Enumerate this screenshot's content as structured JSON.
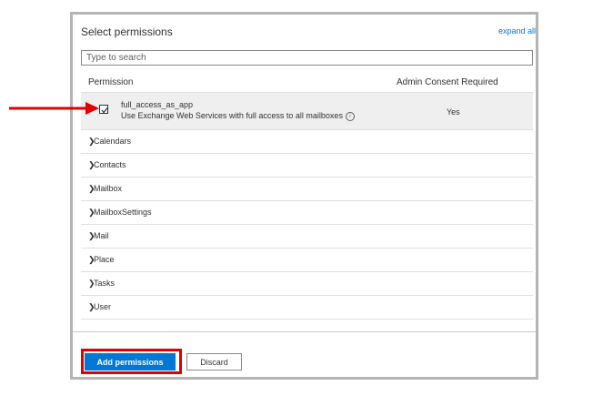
{
  "header": {
    "title": "Select permissions",
    "expand_link": "expand all"
  },
  "search": {
    "placeholder": "Type to search"
  },
  "columns": {
    "permission": "Permission",
    "admin_consent": "Admin Consent Required"
  },
  "selected_permission": {
    "name": "full_access_as_app",
    "description": "Use Exchange Web Services with full access to all mailboxes",
    "info_icon_glyph": "i",
    "admin_consent": "Yes",
    "checked": true
  },
  "groups": [
    {
      "label": "Calendars"
    },
    {
      "label": "Contacts"
    },
    {
      "label": "Mailbox"
    },
    {
      "label": "MailboxSettings"
    },
    {
      "label": "Mail"
    },
    {
      "label": "Place"
    },
    {
      "label": "Tasks"
    },
    {
      "label": "User"
    }
  ],
  "group_chevron": "❯",
  "footer": {
    "add_label": "Add permissions",
    "discard_label": "Discard"
  },
  "colors": {
    "accent": "#0078d4",
    "annotation": "#e00000"
  }
}
